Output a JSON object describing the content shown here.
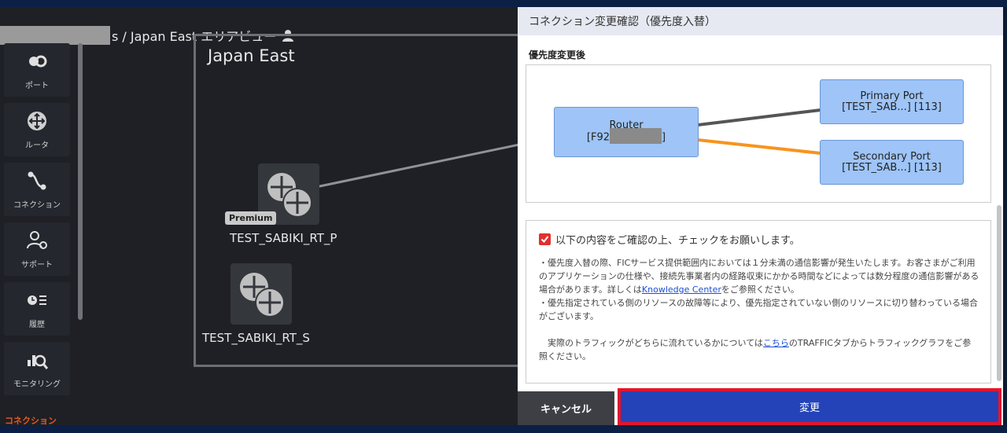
{
  "breadcrumb": {
    "text": "s / Japan East エリアビュー",
    "user_icon": "user-icon"
  },
  "sidebar": {
    "items": [
      {
        "label": "ポート",
        "icon": "port-icon"
      },
      {
        "label": "ルータ",
        "icon": "router-icon"
      },
      {
        "label": "コネクション",
        "icon": "connection-icon"
      },
      {
        "label": "サポート",
        "icon": "support-icon"
      },
      {
        "label": "履歴",
        "icon": "history-icon"
      },
      {
        "label": "モニタリング",
        "icon": "monitoring-icon"
      }
    ],
    "active_section": "コネクション"
  },
  "area": {
    "title": "Japan East",
    "routers": [
      {
        "name": "TEST_SABIKI_RT_P",
        "badge": "Premium"
      },
      {
        "name": "TEST_SABIKI_RT_S"
      }
    ]
  },
  "modal": {
    "title": "コネクション変更確認（優先度入替）",
    "section_title": "優先度変更後",
    "diagram": {
      "router_label": "Router",
      "router_id_prefix": "[F92",
      "router_id_suffix": "]",
      "primary_label": "Primary Port",
      "primary_id": "[TEST_SAB...] [113]",
      "secondary_label": "Secondary Port",
      "secondary_id": "[TEST_SAB...] [113]",
      "primary_color": "#555555",
      "secondary_color": "#f7941d"
    },
    "confirm": {
      "checkbox_label": "以下の内容をご確認の上、チェックをお願いします。",
      "para1_a": "・優先度入替の際、FICサービス提供範囲内においては１分未満の通信影響が発生いたします。お客さまがご利用のアプリケーションの仕様や、接続先事業者内の経路収束にかかる時間などによっては数分程度の通信影響がある場合があります。詳しくは",
      "para1_link": "Knowledge Center",
      "para1_b": "をご参照ください。",
      "para2": "・優先指定されている側のリソースの故障等により、優先指定されていない側のリソースに切り替わっている場合がございます。",
      "para3_a": "　実際のトラフィックがどちらに流れているかについては",
      "para3_link": "こちら",
      "para3_b": "のTRAFFICタブからトラフィックグラフをご参照ください。"
    },
    "cancel_label": "キャンセル",
    "change_label": "変更"
  }
}
